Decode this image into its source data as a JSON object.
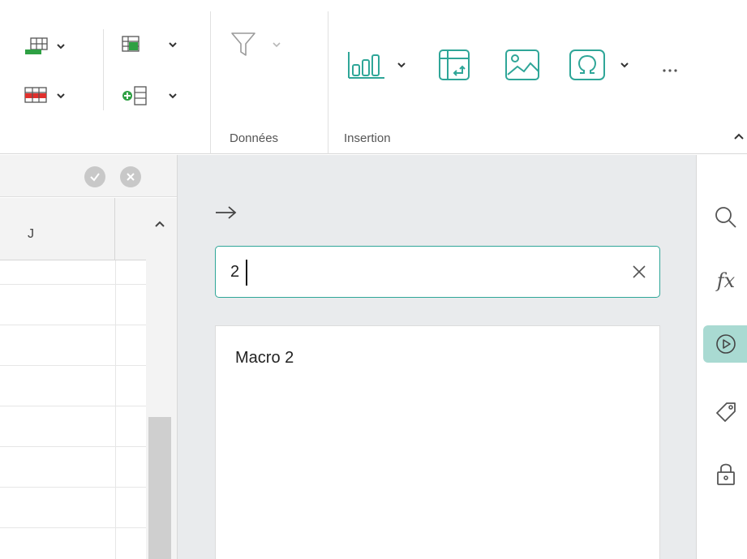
{
  "ribbon": {
    "groups": {
      "data_label": "Données",
      "insert_label": "Insertion"
    },
    "tools": {
      "insert_rows": "insert-rows-icon",
      "delete_rows": "delete-rows-icon",
      "insert_table": "insert-table-icon",
      "insert_columns": "insert-columns-icon",
      "filter": "filter-icon",
      "chart": "bar-chart-icon",
      "pivot_table": "pivot-table-icon",
      "image": "image-icon",
      "symbol": "omega-symbol-icon",
      "more": "more-icon"
    }
  },
  "sheet": {
    "column_label": "J"
  },
  "macro_panel": {
    "search": {
      "value": "2",
      "placeholder": ""
    },
    "results": [
      "Macro 2"
    ]
  },
  "sidebar": {
    "items": [
      "search-icon",
      "function-icon",
      "macro-play-icon",
      "tag-icon",
      "lock-icon"
    ],
    "active": "macro-play-icon",
    "fx_text": "fx"
  },
  "colors": {
    "accent": "#2fa698",
    "active_bg": "#a9dad2",
    "panel_bg": "#e9ebed",
    "green_table": "#2ea043",
    "red_table": "#e0302d"
  }
}
